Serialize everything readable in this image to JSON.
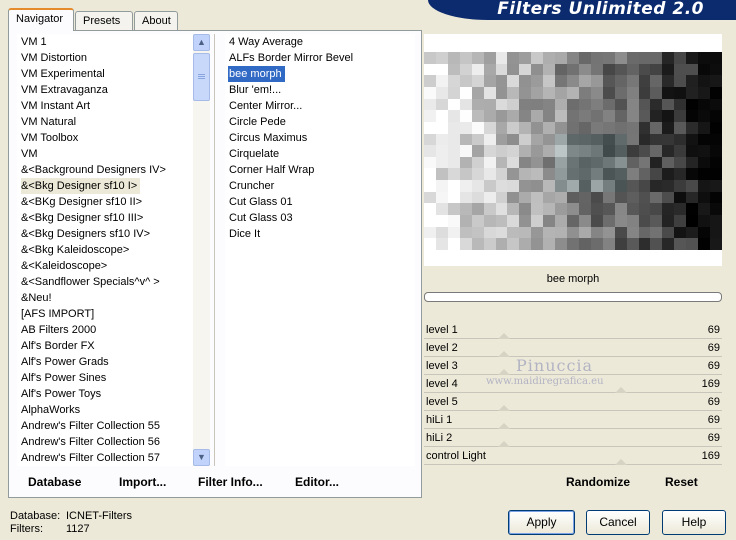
{
  "banner": "Filters Unlimited 2.0",
  "tabs": [
    {
      "label": "Navigator",
      "active": true
    },
    {
      "label": "Presets",
      "active": false
    },
    {
      "label": "About",
      "active": false
    }
  ],
  "categories": [
    "VM 1",
    "VM Distortion",
    "VM Experimental",
    "VM Extravaganza",
    "VM Instant Art",
    "VM Natural",
    "VM Toolbox",
    "VM",
    "&<Background Designers IV>",
    "&<Bkg Designer sf10 I>",
    "&<BKg Designer sf10 II>",
    "&<Bkg Designer sf10 III>",
    "&<Bkg Designers sf10 IV>",
    "&<Bkg Kaleidoscope>",
    "&<Kaleidoscope>",
    "&<Sandflower Specials^v^ >",
    "&Neu!",
    "[AFS IMPORT]",
    "AB Filters 2000",
    "Alf's Border FX",
    "Alf's Power Grads",
    "Alf's Power Sines",
    "Alf's Power Toys",
    "AlphaWorks",
    "Andrew's Filter Collection 55",
    "Andrew's Filter Collection 56",
    "Andrew's Filter Collection 57"
  ],
  "selected_category": "&<Bkg Designer sf10 I>",
  "filters": [
    "4 Way Average",
    "ALFs Border Mirror Bevel",
    "bee morph",
    "Blur 'em!...",
    "Center Mirror...",
    "Circle Pede",
    "Circus Maximus",
    "Cirquelate",
    "Corner Half Wrap",
    "Cruncher",
    "Cut Glass 01",
    "Cut Glass 03",
    "Dice It"
  ],
  "selected_filter": "bee morph",
  "panel_buttons": {
    "database": "Database",
    "import": "Import...",
    "filter_info": "Filter Info...",
    "editor": "Editor..."
  },
  "preview": {
    "filter_name": "bee morph",
    "progress": 0
  },
  "params": [
    {
      "label": "level 1",
      "value": "69",
      "pos": 0.27
    },
    {
      "label": "level 2",
      "value": "69",
      "pos": 0.27
    },
    {
      "label": "level 3",
      "value": "69",
      "pos": 0.27
    },
    {
      "label": "level 4",
      "value": "169",
      "pos": 0.66
    },
    {
      "label": "level 5",
      "value": "69",
      "pos": 0.27
    },
    {
      "label": "hiLi 1",
      "value": "69",
      "pos": 0.27
    },
    {
      "label": "hiLi 2",
      "value": "69",
      "pos": 0.27
    },
    {
      "label": "control Light",
      "value": "169",
      "pos": 0.66
    }
  ],
  "watermark": {
    "line1": "Pinuccia",
    "line2": "www.maidiregrafica.eu"
  },
  "right_buttons": {
    "randomize": "Randomize",
    "reset": "Reset"
  },
  "footer": {
    "database_label": "Database:",
    "database_value": "ICNET-Filters",
    "filters_label": "Filters:",
    "filters_value": "1127"
  },
  "dialog_buttons": {
    "apply": "Apply",
    "cancel": "Cancel",
    "help": "Help"
  }
}
